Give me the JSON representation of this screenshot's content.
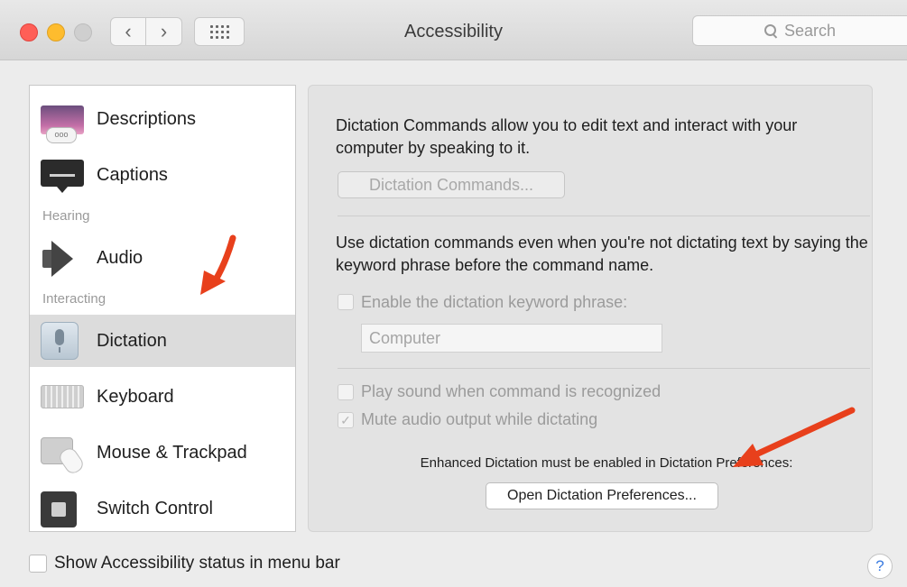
{
  "window": {
    "title": "Accessibility"
  },
  "search": {
    "placeholder": "Search"
  },
  "sidebar": {
    "items": [
      {
        "label": "Descriptions",
        "icon": "descriptions-icon"
      },
      {
        "label": "Captions",
        "icon": "captions-icon"
      },
      {
        "label": "Audio",
        "icon": "speaker-icon"
      },
      {
        "label": "Dictation",
        "icon": "microphone-icon",
        "selected": true
      },
      {
        "label": "Keyboard",
        "icon": "keyboard-icon"
      },
      {
        "label": "Mouse & Trackpad",
        "icon": "mouse-trackpad-icon"
      },
      {
        "label": "Switch Control",
        "icon": "switch-control-icon"
      }
    ],
    "sections": {
      "hearing": "Hearing",
      "interacting": "Interacting"
    }
  },
  "main": {
    "intro": "Dictation Commands allow you to edit text and interact with your computer by speaking to it.",
    "dictation_commands_button": "Dictation Commands...",
    "keyword_desc": "Use dictation commands even when you're not dictating text by saying the keyword phrase before the command name.",
    "enable_keyword_label": "Enable the dictation keyword phrase:",
    "keyword_value": "Computer",
    "play_sound_label": "Play sound when command is recognized",
    "mute_audio_label": "Mute audio output while dictating",
    "mute_checked": true,
    "enhanced_note": "Enhanced Dictation must be enabled in Dictation Preferences:",
    "open_prefs_button": "Open Dictation Preferences..."
  },
  "footer": {
    "show_status_label": "Show Accessibility status in menu bar",
    "help_symbol": "?"
  },
  "colors": {
    "close": "#ff5f57",
    "minimize": "#febc2e",
    "annotation_arrow": "#e8401c",
    "help": "#3a7be0"
  }
}
